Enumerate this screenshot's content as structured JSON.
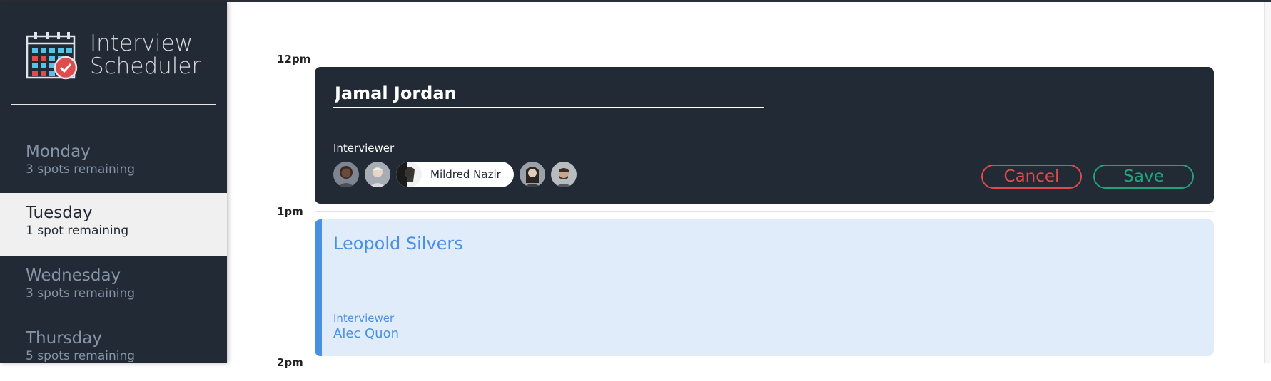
{
  "app": {
    "title_line1": "Interview",
    "title_line2": "Scheduler"
  },
  "sidebar": {
    "days": [
      {
        "name": "Monday",
        "spots": "3 spots remaining",
        "selected": false
      },
      {
        "name": "Tuesday",
        "spots": "1 spot remaining",
        "selected": true
      },
      {
        "name": "Wednesday",
        "spots": "3 spots remaining",
        "selected": false
      },
      {
        "name": "Thursday",
        "spots": "5 spots remaining",
        "selected": false
      }
    ]
  },
  "schedule": {
    "times": [
      "12pm",
      "1pm",
      "2pm"
    ],
    "form": {
      "student_value": "Jamal Jordan",
      "interviewer_label": "Interviewer",
      "selected_interviewer": "Mildred Nazir",
      "cancel_label": "Cancel",
      "save_label": "Save"
    },
    "appointment": {
      "student": "Leopold Silvers",
      "interviewer_label": "Interviewer",
      "interviewer": "Alec Quon"
    }
  },
  "colors": {
    "sidebar_bg": "#222a35",
    "cancel": "#e04b4b",
    "save": "#24a37a",
    "accent_blue": "#4a90e2",
    "card_bg": "#e1ecfb"
  }
}
